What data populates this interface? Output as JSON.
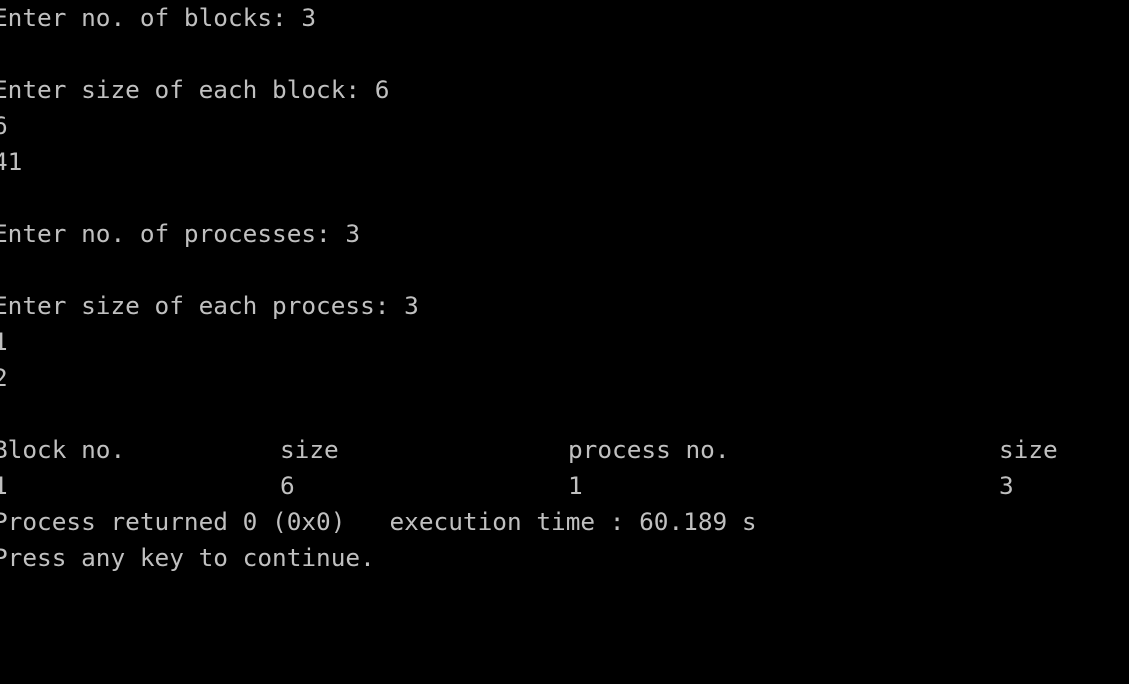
{
  "console": {
    "lines": [
      "Enter no. of blocks: 3",
      "",
      "Enter size of each block: 6",
      "6",
      "41",
      "",
      "Enter no. of processes: 3",
      "",
      "Enter size of each process: 3",
      "1",
      "2",
      ""
    ],
    "table": {
      "headers": [
        "Block no.",
        "size",
        "process no.",
        "size"
      ],
      "rows": [
        [
          "1",
          "6",
          "1",
          "3"
        ]
      ]
    },
    "footer": [
      "Process returned 0 (0x0)   execution time : 60.189 s",
      "Press any key to continue."
    ]
  }
}
